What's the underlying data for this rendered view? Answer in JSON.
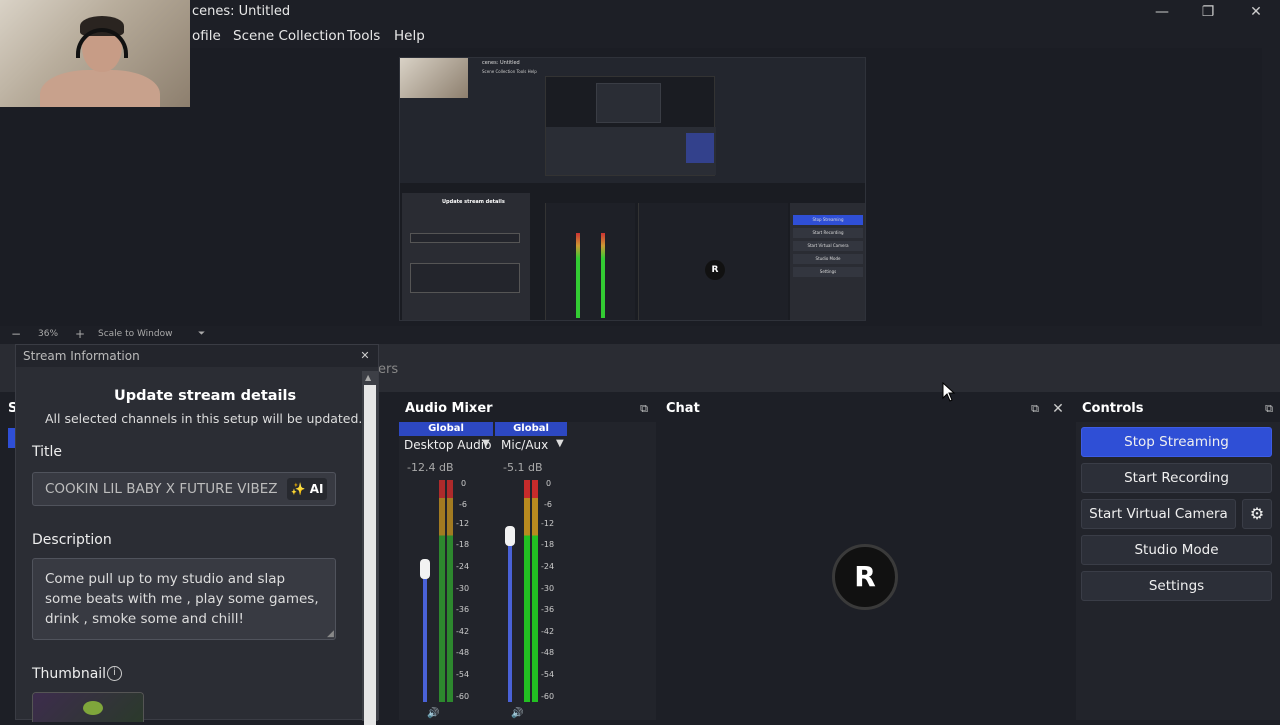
{
  "window": {
    "title": "cenes: Untitled",
    "minimize_glyph": "—",
    "maximize_glyph": "❐",
    "close_glyph": "✕"
  },
  "menu": {
    "items": [
      "ofile",
      "Scene Collection",
      "Tools",
      "Help"
    ]
  },
  "preview": {
    "mini_title": "cenes: Untitled",
    "mini_menu": "Scene Collection   Tools   Help",
    "mini_stream_title": "Update stream details",
    "mini_r": "R",
    "mini_controls": [
      "Stop Streaming",
      "Start Recording",
      "Start Virtual Camera",
      "Studio Mode",
      "Settings"
    ]
  },
  "zoom_bar": {
    "minus": "−",
    "zoom": "36%",
    "plus": "+",
    "scale_mode": "Scale to Window",
    "dropdown_glyph": "⏷"
  },
  "docks": {
    "scenes_fragment": "ers",
    "left_fragment": "S",
    "audio_mixer": {
      "title": "Audio Mixer",
      "channels": [
        {
          "tag": "Global",
          "name": "Desktop Audio",
          "db": "-12.4 dB",
          "level": 0.55
        },
        {
          "tag": "Global",
          "name": "Mic/Aux",
          "db": "-5.1 dB",
          "level": 0.78
        }
      ],
      "scale": [
        "0",
        "-6",
        "-12",
        "-18",
        "-24",
        "-30",
        "-36",
        "-42",
        "-48",
        "-54",
        "-60"
      ]
    },
    "chat": {
      "title": "Chat",
      "avatar_letter": "R"
    },
    "controls": {
      "title": "Controls",
      "buttons": {
        "stop_streaming": "Stop Streaming",
        "start_recording": "Start Recording",
        "start_virtual_camera": "Start Virtual Camera",
        "studio_mode": "Studio Mode",
        "settings": "Settings"
      }
    }
  },
  "stream_info": {
    "header": "Stream Information",
    "heading": "Update stream details",
    "subheading": "All selected channels in this setup will be updated.",
    "title_label": "Title",
    "title_value": "COOKIN LIL BABY X FUTURE VIBEZ",
    "ai_label": "AI",
    "description_label": "Description",
    "description_value": "Come pull up to my studio and slap some beats with me , play some games, drink , smoke some and chill!",
    "thumbnail_label": "Thumbnail"
  },
  "colors": {
    "accent": "#2f4fd6",
    "panel": "#22242b",
    "background": "#1d1f26"
  }
}
